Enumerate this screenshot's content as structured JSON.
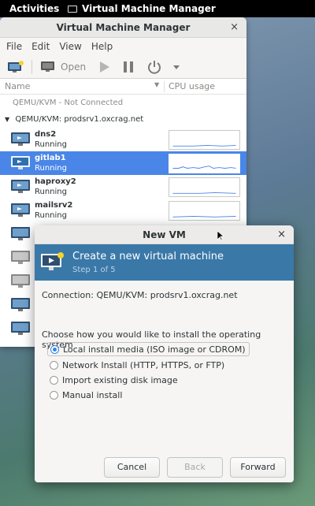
{
  "topbar": {
    "activities": "Activities",
    "app_name": "Virtual Machine Manager"
  },
  "main_window": {
    "title": "Virtual Machine Manager",
    "menu": [
      "File",
      "Edit",
      "View",
      "Help"
    ],
    "toolbar": {
      "open_label": "Open"
    },
    "columns": {
      "name": "Name",
      "cpu": "CPU usage"
    },
    "connections": [
      {
        "label": "QEMU/KVM - Not Connected"
      },
      {
        "label": "QEMU/KVM: prodsrv1.oxcrag.net"
      }
    ],
    "vms": [
      {
        "name": "dns2",
        "status": "Running"
      },
      {
        "name": "gitlab1",
        "status": "Running"
      },
      {
        "name": "haproxy2",
        "status": "Running"
      },
      {
        "name": "mailsrv2",
        "status": "Running"
      }
    ]
  },
  "dialog": {
    "title": "New VM",
    "header_title": "Create a new virtual machine",
    "header_step": "Step 1 of 5",
    "connection": "Connection:  QEMU/KVM: prodsrv1.oxcrag.net",
    "prompt": "Choose how you would like to install the operating system",
    "options": [
      {
        "label": "Local install media (ISO image or CDROM)"
      },
      {
        "label": "Network Install (HTTP, HTTPS, or FTP)"
      },
      {
        "label": "Import existing disk image"
      },
      {
        "label": "Manual install"
      }
    ],
    "selected_option": "Local install media (ISO image or CDROM)",
    "buttons": {
      "cancel": "Cancel",
      "back": "Back",
      "forward": "Forward"
    }
  },
  "colors": {
    "selection": "#4a86e8",
    "banner": "#3a78a8",
    "radio": "#3584e4"
  }
}
